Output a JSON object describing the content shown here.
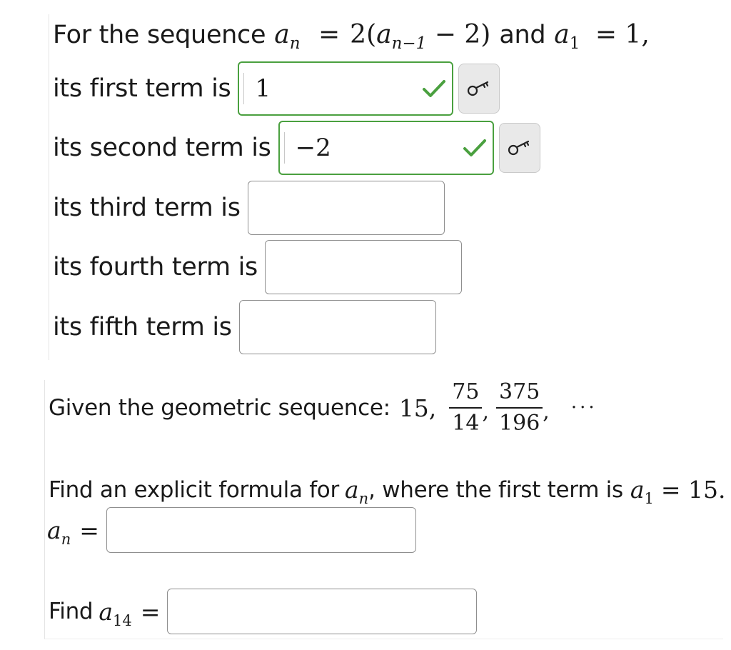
{
  "q1": {
    "intro_prefix": "For the sequence",
    "formula_lhs_var": "a",
    "formula_lhs_sub": "n",
    "formula_eq": "=",
    "formula_rhs_open": "2(",
    "formula_rhs_var": "a",
    "formula_rhs_sub": "n−1",
    "formula_rhs_close": " − 2)",
    "intro_and": "and",
    "init_var": "a",
    "init_sub": "1",
    "init_eq": "= 1,",
    "terms": [
      {
        "label": "its first term is",
        "value": "1",
        "status": "correct"
      },
      {
        "label": "its second term is",
        "value": "−2",
        "status": "correct"
      },
      {
        "label": "its third term is",
        "value": "",
        "status": "empty"
      },
      {
        "label": "its fourth term is",
        "value": "",
        "status": "empty"
      },
      {
        "label": "its fifth term is",
        "value": "",
        "status": "empty"
      }
    ]
  },
  "q2": {
    "given_label": "Given the geometric sequence:",
    "first_term": "15,",
    "fractions": [
      {
        "num": "75",
        "den": "14"
      },
      {
        "num": "375",
        "den": "196"
      }
    ],
    "comma": ",",
    "ellipsis": "···",
    "find_prefix": "Find an explicit formula for",
    "find_var": "a",
    "find_sub": "n",
    "find_mid": ", where the first term is",
    "first_var": "a",
    "first_sub": "1",
    "first_eq": "= 15.",
    "an_var": "a",
    "an_sub": "n",
    "an_eq": "=",
    "an_value": "",
    "find_a14_prefix": "Find",
    "a14_var": "a",
    "a14_sub": "14",
    "a14_eq": "=",
    "a14_value": ""
  },
  "colors": {
    "correct": "#4aa03f",
    "border": "#8f8f8f",
    "key_button": "#e9e9e9"
  },
  "icons": {
    "check": "check-icon",
    "key": "key-icon"
  }
}
